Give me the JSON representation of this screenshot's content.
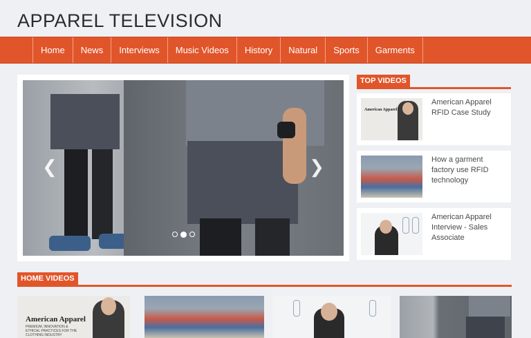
{
  "site": {
    "title": "APPAREL TELEVISION"
  },
  "nav": {
    "items": [
      "Home",
      "News",
      "Interviews",
      "Music Videos",
      "History",
      "Natural",
      "Sports",
      "Garments"
    ]
  },
  "slider": {
    "prev_glyph": "❮",
    "next_glyph": "❯",
    "dot_count": 3,
    "active_dot": 2
  },
  "top_videos": {
    "heading": "TOP VIDEOS",
    "items": [
      {
        "title": "American Apparel RFID Case Study",
        "thumb_brand": "American Apparel"
      },
      {
        "title": "How a garment factory use RFID technology"
      },
      {
        "title": "American Apparel Interview - Sales Associate"
      }
    ]
  },
  "home_videos": {
    "heading": "HOME VIDEOS",
    "first_thumb_brand": "American Apparel",
    "first_thumb_sub": "PREMIUM, INNOVATION & ETHICAL PRACTICES FOR THE CLOTHING INDUSTRY"
  },
  "colors": {
    "accent": "#e1552a",
    "background": "#eef0f4"
  }
}
